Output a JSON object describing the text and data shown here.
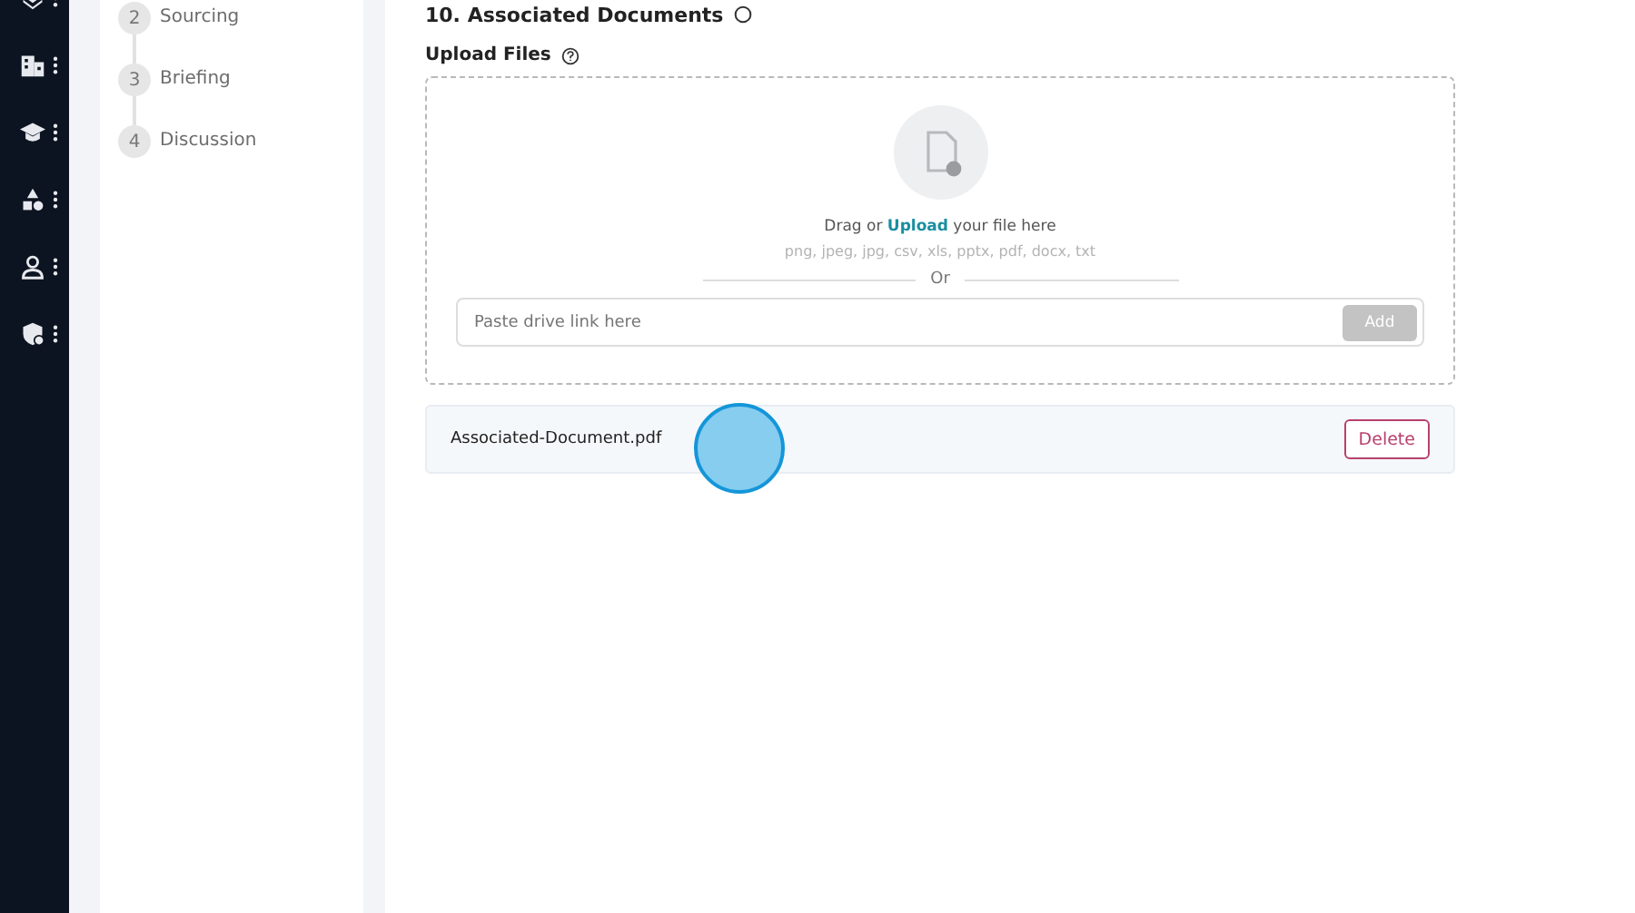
{
  "sidebar": {
    "items": [
      {
        "kind": "layers"
      },
      {
        "kind": "building"
      },
      {
        "kind": "cap"
      },
      {
        "kind": "shapes"
      },
      {
        "kind": "person"
      },
      {
        "kind": "shield"
      }
    ]
  },
  "steps": [
    {
      "number": "2",
      "label": "Sourcing"
    },
    {
      "number": "3",
      "label": "Briefing"
    },
    {
      "number": "4",
      "label": "Discussion"
    }
  ],
  "section": {
    "title": "10. Associated Documents"
  },
  "upload": {
    "label": "Upload Files",
    "prompt_before": "Drag or ",
    "prompt_link": "Upload",
    "prompt_after": " your file here",
    "formats": "png, jpeg, jpg, csv, xls, pptx, pdf, docx, txt",
    "or": "Or",
    "link_field": {
      "placeholder": "Paste drive link here"
    },
    "add_button": "Add",
    "add_disabled": true
  },
  "files": [
    {
      "name": "Associated-Document.pdf",
      "action": "Delete"
    }
  ],
  "click_marker": true
}
